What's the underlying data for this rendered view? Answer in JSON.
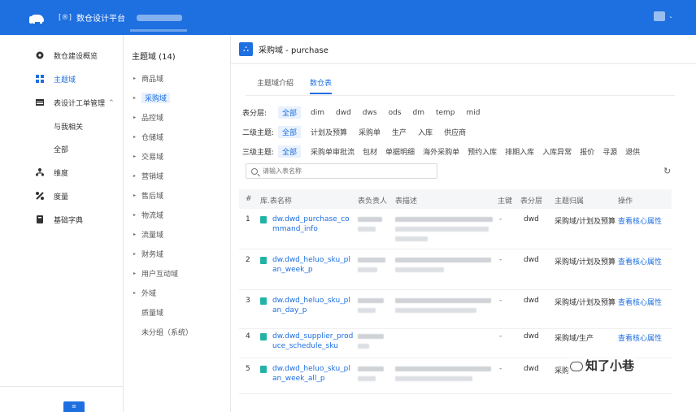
{
  "topbar": {
    "title": "数仓设计平台",
    "app_glyph": "[®]"
  },
  "leftnav": {
    "items": [
      {
        "label": "数仓建设概览",
        "icon": "dashboard-icon"
      },
      {
        "label": "主题域",
        "icon": "grid-icon",
        "active": true
      },
      {
        "label": "表设计工单管理",
        "icon": "table-icon",
        "caret": "^"
      },
      {
        "label": "与我相关",
        "sub": true
      },
      {
        "label": "全部",
        "sub": true
      },
      {
        "label": "维度",
        "icon": "hierarchy-icon"
      },
      {
        "label": "度量",
        "icon": "metric-icon"
      },
      {
        "label": "基础字典",
        "icon": "book-icon"
      }
    ],
    "collapse_label": "≡"
  },
  "domains": {
    "header": "主题域 (14)",
    "items": [
      "商品域",
      "采购域",
      "品控域",
      "仓储域",
      "交易域",
      "营销域",
      "售后域",
      "物流域",
      "流量域",
      "财务域",
      "用户互动域",
      "外域",
      "质量域",
      "未分组（系统）"
    ]
  },
  "main": {
    "title": "采购域 - purchase",
    "tabs": [
      "主题域介绍",
      "数仓表"
    ],
    "filters": {
      "layer": {
        "label": "表分层:",
        "options": [
          "全部",
          "dim",
          "dwd",
          "dws",
          "ods",
          "dm",
          "temp",
          "mid"
        ]
      },
      "sub2": {
        "label": "二级主题:",
        "options": [
          "全部",
          "计划及预算",
          "采购单",
          "生产",
          "入库",
          "供应商"
        ]
      },
      "sub3": {
        "label": "三级主题:",
        "options": [
          "全部",
          "采购单审批流",
          "包材",
          "单据明细",
          "海外采购单",
          "预约入库",
          "排期入库",
          "入库异常",
          "报价",
          "寻源",
          "退供"
        ]
      }
    },
    "search_placeholder": "请输入表名称",
    "columns": [
      "#",
      "库.表名称",
      "表负责人",
      "表描述",
      "主键",
      "表分层",
      "主题归属",
      "操作"
    ],
    "rows": [
      {
        "no": "1",
        "name": "dw.dwd_purchase_command_info",
        "pk": "-",
        "layer": "dwd",
        "subject": "采购域/计划及预算",
        "action": "查看核心属性"
      },
      {
        "no": "2",
        "name": "dw.dwd_heluo_sku_plan_week_p",
        "pk": "-",
        "layer": "dwd",
        "subject": "采购域/计划及预算",
        "action": "查看核心属性"
      },
      {
        "no": "3",
        "name": "dw.dwd_heluo_sku_plan_day_p",
        "pk": "-",
        "layer": "dwd",
        "subject": "采购域/计划及预算",
        "action": "查看核心属性"
      },
      {
        "no": "4",
        "name": "dw.dwd_supplier_produce_schedule_sku",
        "pk": "-",
        "layer": "dwd",
        "subject": "采购域/生产",
        "action": "查看核心属性"
      },
      {
        "no": "5",
        "name": "dw.dwd_heluo_sku_plan_week_all_p",
        "pk": "-",
        "layer": "dwd",
        "subject": "采购",
        "action": ""
      }
    ]
  },
  "watermark": "知了小巷",
  "colors": {
    "accent": "#1e6fe0",
    "table_icon": "#22b3a6"
  }
}
